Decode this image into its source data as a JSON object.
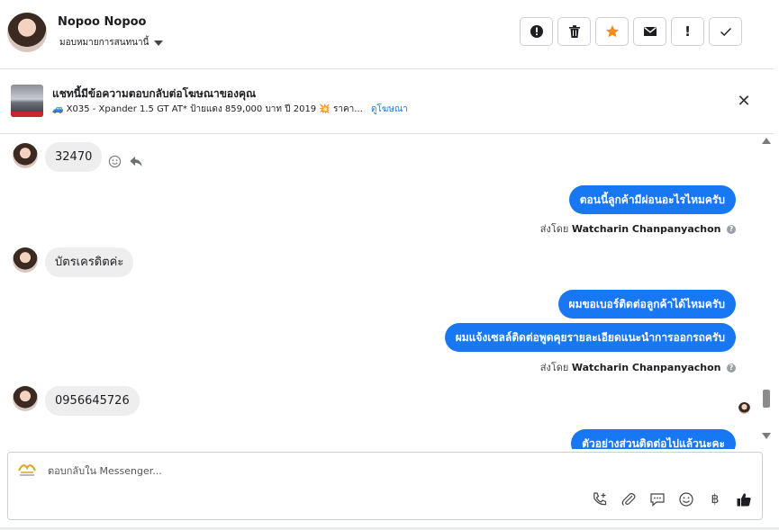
{
  "header": {
    "contact_name": "Nopoo Nopoo",
    "assign_label": "มอบหมายการสนทนานี้",
    "actions": [
      {
        "name": "spam-button",
        "icon": "alert-circle-icon",
        "glyph": "!"
      },
      {
        "name": "delete-button",
        "icon": "trash-icon",
        "glyph": ""
      },
      {
        "name": "star-button",
        "icon": "star-icon",
        "glyph": "★"
      },
      {
        "name": "mark-unread-button",
        "icon": "envelope-icon",
        "glyph": ""
      },
      {
        "name": "follow-up-button",
        "icon": "exclamation-icon",
        "glyph": "!"
      },
      {
        "name": "done-button",
        "icon": "check-icon",
        "glyph": "✓"
      }
    ],
    "star_color": "#f5891b"
  },
  "ad": {
    "title": "แชทนี้มีข้อความตอบกลับต่อโฆษณาของคุณ",
    "description": "🚙 X035 - Xpander 1.5 GT AT* ป้ายแดง 859,000 บาท ปี 2019 💥 ราคา...",
    "link_label": "ดูโฆษณา",
    "close_icon": "close-icon"
  },
  "messages": {
    "in_1": "32470",
    "out_1": "ตอนนี้ลูกค้ามีผ่อนอะไรไหมครับ",
    "sent_by_prefix": "ส่งโดย",
    "sent_by_name": "Watcharin Chanpanyachon",
    "in_2": "บัตรเครดิตค่ะ",
    "out_2a": "ผมขอเบอร์ติดต่อลูกค้าได้ไหมครับ",
    "out_2b": "ผมแจ้งเซลล์ติดต่อพูดคุยรายละเอียดแนะนำการออกรถครับ",
    "in_3": "0956645726",
    "out_3": "ตัวอย่างส่วนติดต่อไปแล้วนะคะ"
  },
  "composer": {
    "placeholder": "ตอบกลับใน Messenger...",
    "tools": [
      "call-add-icon",
      "attachment-icon",
      "saved-reply-icon",
      "emoji-icon",
      "baht-icon",
      "thumbs-up-icon"
    ],
    "baht_glyph": "฿"
  },
  "colors": {
    "accent": "#1877f2",
    "bubble_in": "#eeeeee",
    "border": "#dddfe2"
  }
}
